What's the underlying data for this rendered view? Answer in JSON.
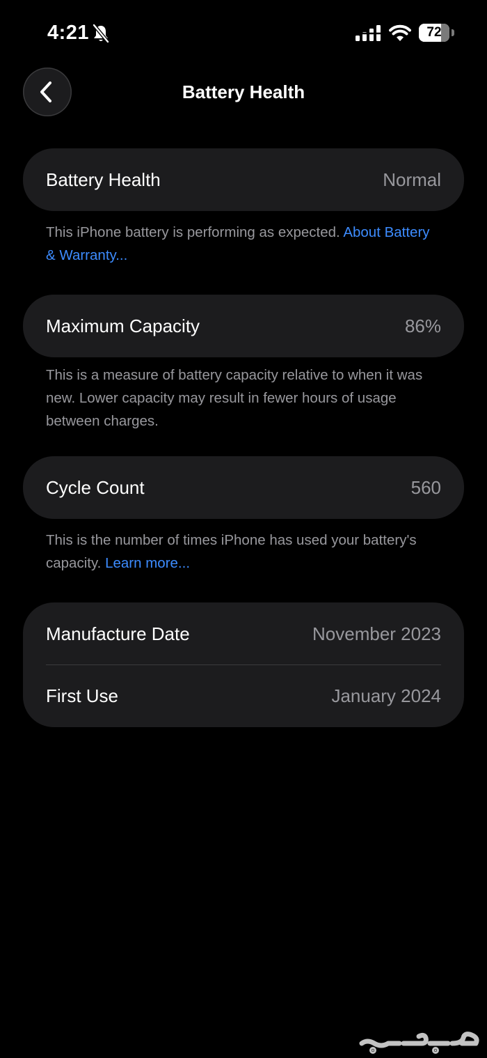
{
  "status_bar": {
    "time": "4:21",
    "battery_level": "72",
    "battery_fraction": 0.72
  },
  "nav": {
    "title": "Battery Health"
  },
  "battery_health": {
    "label": "Battery Health",
    "value": "Normal",
    "note": "This iPhone battery is performing as expected.",
    "link": "About Battery & Warranty..."
  },
  "max_capacity": {
    "label": "Maximum Capacity",
    "value": "86%",
    "note": "This is a measure of battery capacity relative to when it was new. Lower capacity may result in fewer hours of usage between charges."
  },
  "cycle_count": {
    "label": "Cycle Count",
    "value": "560",
    "note": "This is the number of times iPhone has used your battery's capacity.",
    "link": "Learn more..."
  },
  "dates": {
    "manufacture_label": "Manufacture Date",
    "manufacture_value": "November 2023",
    "first_use_label": "First Use",
    "first_use_value": "January 2024"
  },
  "colors": {
    "background": "#000000",
    "card": "#1c1c1e",
    "secondary_text": "#98989d",
    "link": "#3d8cff"
  },
  "icons": {
    "back": "chevron-left-icon",
    "silent": "bell-slash-icon",
    "signal": "cellular-signal-icon",
    "wifi": "wifi-icon",
    "battery": "battery-icon",
    "watermark": "haraj-logo"
  }
}
